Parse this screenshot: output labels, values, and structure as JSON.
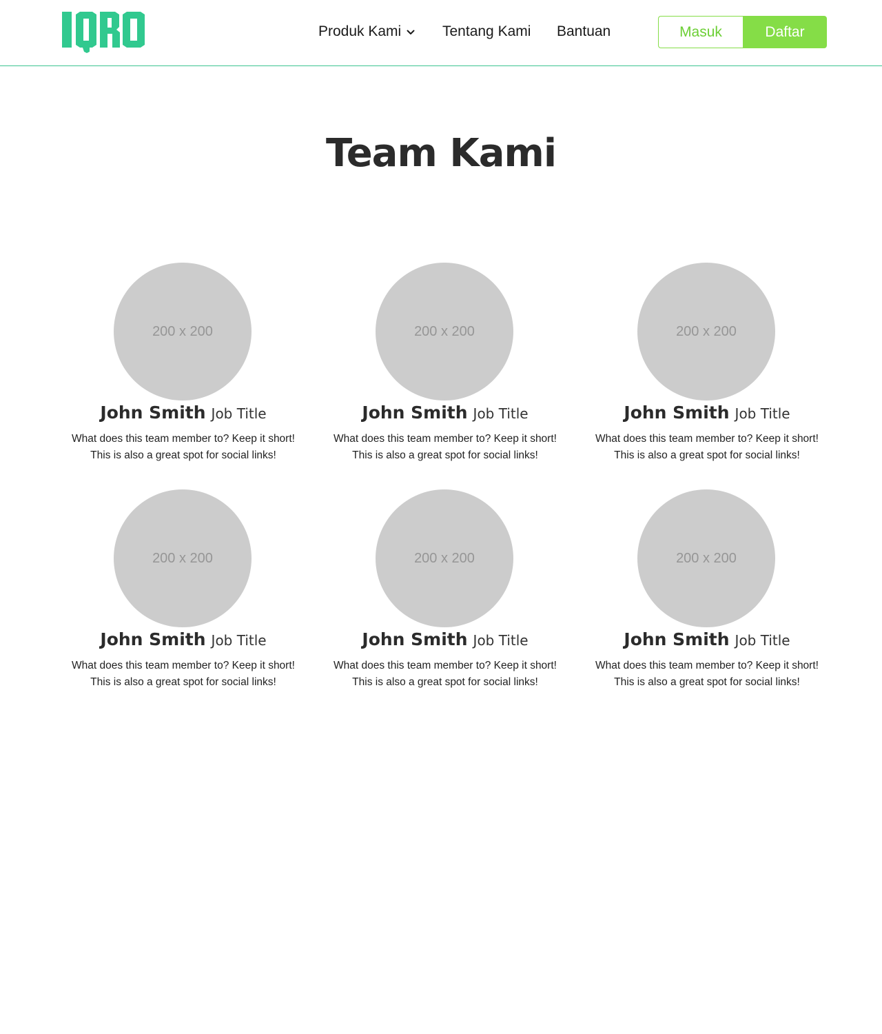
{
  "brand": {
    "logo_text": "IQRO",
    "color": "#31c98f"
  },
  "nav": {
    "produk_label": "Produk Kami",
    "tentang_label": "Tentang Kami",
    "bantuan_label": "Bantuan"
  },
  "auth": {
    "login_label": "Masuk",
    "signup_label": "Daftar",
    "accent": "#85dd47"
  },
  "page": {
    "title": "Team Kami"
  },
  "team": [
    {
      "avatar_text": "200 x 200",
      "name": "John Smith",
      "role": "Job Title",
      "line1": "What does this team member to? Keep it short!",
      "line2": "This is also a great spot for social links!"
    },
    {
      "avatar_text": "200 x 200",
      "name": "John Smith",
      "role": "Job Title",
      "line1": "What does this team member to? Keep it short!",
      "line2": "This is also a great spot for social links!"
    },
    {
      "avatar_text": "200 x 200",
      "name": "John Smith",
      "role": "Job Title",
      "line1": "What does this team member to? Keep it short!",
      "line2": "This is also a great spot for social links!"
    },
    {
      "avatar_text": "200 x 200",
      "name": "John Smith",
      "role": "Job Title",
      "line1": "What does this team member to? Keep it short!",
      "line2": "This is also a great spot for social links!"
    },
    {
      "avatar_text": "200 x 200",
      "name": "John Smith",
      "role": "Job Title",
      "line1": "What does this team member to? Keep it short!",
      "line2": "This is also a great spot for social links!"
    },
    {
      "avatar_text": "200 x 200",
      "name": "John Smith",
      "role": "Job Title",
      "line1": "What does this team member to? Keep it short!",
      "line2": "This is also a great spot for social links!"
    }
  ]
}
